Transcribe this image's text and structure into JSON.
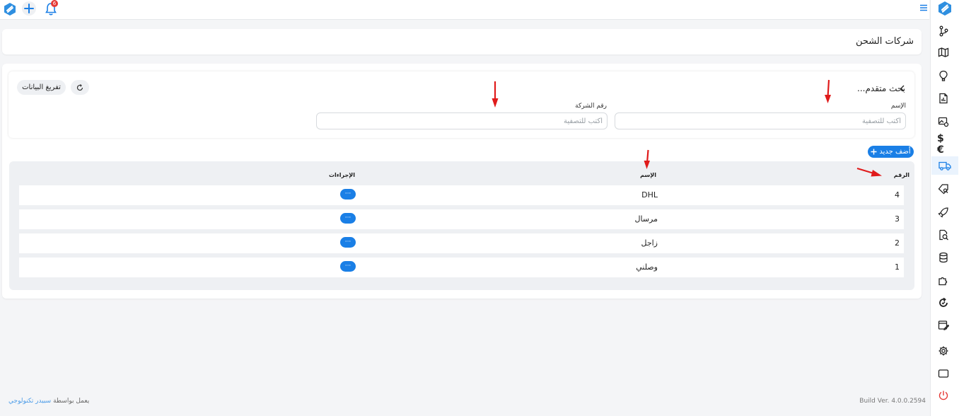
{
  "topbar": {
    "notification_count": "6"
  },
  "sidebar": {
    "currency_label": "$€",
    "items": [
      "git-branch-icon",
      "map-icon",
      "hot-air-balloon-icon",
      "document-chart-icon",
      "image-settings-icon",
      "currency-icon",
      "truck-icon",
      "tag-search-icon",
      "rocket-icon",
      "search-document-icon",
      "database-icon",
      "puzzle-icon",
      "refresh-icon",
      "edit-window-icon",
      "gear-icon",
      "window-icon",
      "power-icon"
    ],
    "active_item": "truck-icon"
  },
  "header": {
    "title": "شركات الشحن"
  },
  "filters": {
    "advanced_search_label": "بحث متقدم...",
    "clear_label": "تفريغ البيانات",
    "name_label": "الإسم",
    "name_placeholder": "أكتب للتصفية",
    "company_number_label": "رقم الشركة",
    "company_number_placeholder": "أكتب للتصفية"
  },
  "add_button": {
    "label": "أضف جديد"
  },
  "table": {
    "headers": {
      "number": "الرقم",
      "name": "الإسم",
      "actions": "الإجراءات"
    },
    "actions_label": "···",
    "rows": [
      {
        "number": "4",
        "name": "DHL"
      },
      {
        "number": "3",
        "name": "مرسال"
      },
      {
        "number": "2",
        "name": "زاجل"
      },
      {
        "number": "1",
        "name": "وصلني"
      }
    ]
  },
  "footer": {
    "powered_by": "يعمل بواسطة",
    "company": "سبيدر تكنولوجي",
    "build": "Build Ver. 4.0.0.2594"
  },
  "colors": {
    "accent": "#1a7fe6",
    "annotation": "#e01b1b",
    "badge": "#e53935"
  }
}
